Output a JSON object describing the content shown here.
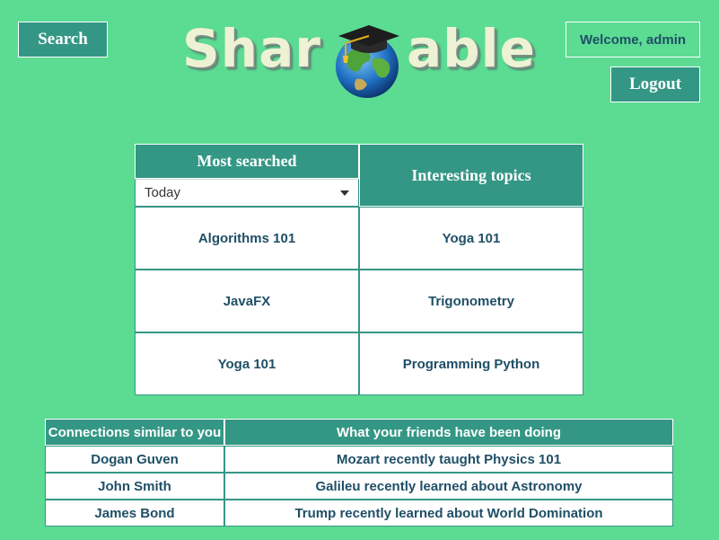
{
  "header": {
    "search_label": "Search",
    "welcome_text": "Welcome, admin",
    "logout_label": "Logout",
    "logo": {
      "left": "Shar",
      "right": "able"
    }
  },
  "topics": {
    "most_searched_title": "Most searched",
    "period_selected": "Today",
    "interesting_title": "Interesting topics",
    "most_searched": [
      "Algorithms 101",
      "JavaFX",
      "Yoga 101"
    ],
    "interesting": [
      "Yoga 101",
      "Trigonometry",
      "Programming Python"
    ]
  },
  "connections": {
    "col1_header": "Connections similar to you",
    "col2_header": "What your friends have been doing",
    "rows": [
      {
        "name": "Dogan Guven",
        "activity": "Mozart recently taught Physics 101"
      },
      {
        "name": "John Smith",
        "activity": "Galileu recently learned about Astronomy"
      },
      {
        "name": "James Bond",
        "activity": "Trump recently learned about World Domination"
      }
    ]
  },
  "colors": {
    "background": "#5cdb93",
    "accent": "#349785",
    "text_dark": "#1f4f66"
  }
}
